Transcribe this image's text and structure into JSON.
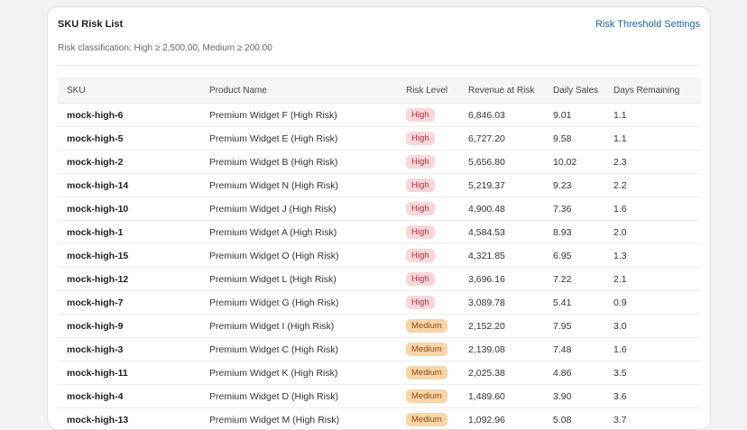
{
  "card": {
    "title": "SKU Risk List",
    "settings_link": "Risk Threshold Settings",
    "subtitle": "Risk classification: High ≥ 2,500.00, Medium ≥ 200.00"
  },
  "table": {
    "columns": [
      "SKU",
      "Product Name",
      "Risk Level",
      "Revenue at Risk",
      "Daily Sales",
      "Days Remaining"
    ],
    "rows": [
      {
        "sku": "mock-high-6",
        "name": "Premium Widget F (High Risk)",
        "risk": "High",
        "revenue": "6,846.03",
        "daily": "9.01",
        "days": "1.1"
      },
      {
        "sku": "mock-high-5",
        "name": "Premium Widget E (High Risk)",
        "risk": "High",
        "revenue": "6,727.20",
        "daily": "9.58",
        "days": "1.1"
      },
      {
        "sku": "mock-high-2",
        "name": "Premium Widget B (High Risk)",
        "risk": "High",
        "revenue": "5,656.80",
        "daily": "10.02",
        "days": "2.3"
      },
      {
        "sku": "mock-high-14",
        "name": "Premium Widget N (High Risk)",
        "risk": "High",
        "revenue": "5,219.37",
        "daily": "9.23",
        "days": "2.2"
      },
      {
        "sku": "mock-high-10",
        "name": "Premium Widget J (High Risk)",
        "risk": "High",
        "revenue": "4,900.48",
        "daily": "7.36",
        "days": "1.6"
      },
      {
        "sku": "mock-high-1",
        "name": "Premium Widget A (High Risk)",
        "risk": "High",
        "revenue": "4,584.53",
        "daily": "8.93",
        "days": "2.0"
      },
      {
        "sku": "mock-high-15",
        "name": "Premium Widget O (High Risk)",
        "risk": "High",
        "revenue": "4,321.85",
        "daily": "6.95",
        "days": "1.3"
      },
      {
        "sku": "mock-high-12",
        "name": "Premium Widget L (High Risk)",
        "risk": "High",
        "revenue": "3,696.16",
        "daily": "7.22",
        "days": "2.1"
      },
      {
        "sku": "mock-high-7",
        "name": "Premium Widget G (High Risk)",
        "risk": "High",
        "revenue": "3,089.78",
        "daily": "5.41",
        "days": "0.9"
      },
      {
        "sku": "mock-high-9",
        "name": "Premium Widget I (High Risk)",
        "risk": "Medium",
        "revenue": "2,152.20",
        "daily": "7.95",
        "days": "3.0"
      },
      {
        "sku": "mock-high-3",
        "name": "Premium Widget C (High Risk)",
        "risk": "Medium",
        "revenue": "2,139.08",
        "daily": "7.48",
        "days": "1.6"
      },
      {
        "sku": "mock-high-11",
        "name": "Premium Widget K (High Risk)",
        "risk": "Medium",
        "revenue": "2,025.38",
        "daily": "4.86",
        "days": "3.5"
      },
      {
        "sku": "mock-high-4",
        "name": "Premium Widget D (High Risk)",
        "risk": "Medium",
        "revenue": "1,489.60",
        "daily": "3.90",
        "days": "3.6"
      },
      {
        "sku": "mock-high-13",
        "name": "Premium Widget M (High Risk)",
        "risk": "Medium",
        "revenue": "1,092.96",
        "daily": "5.08",
        "days": "3.7"
      }
    ]
  },
  "colors": {
    "link": "#1f5fae",
    "high_badge_bg": "#f8d7da",
    "medium_badge_bg": "#f8d5a8"
  }
}
